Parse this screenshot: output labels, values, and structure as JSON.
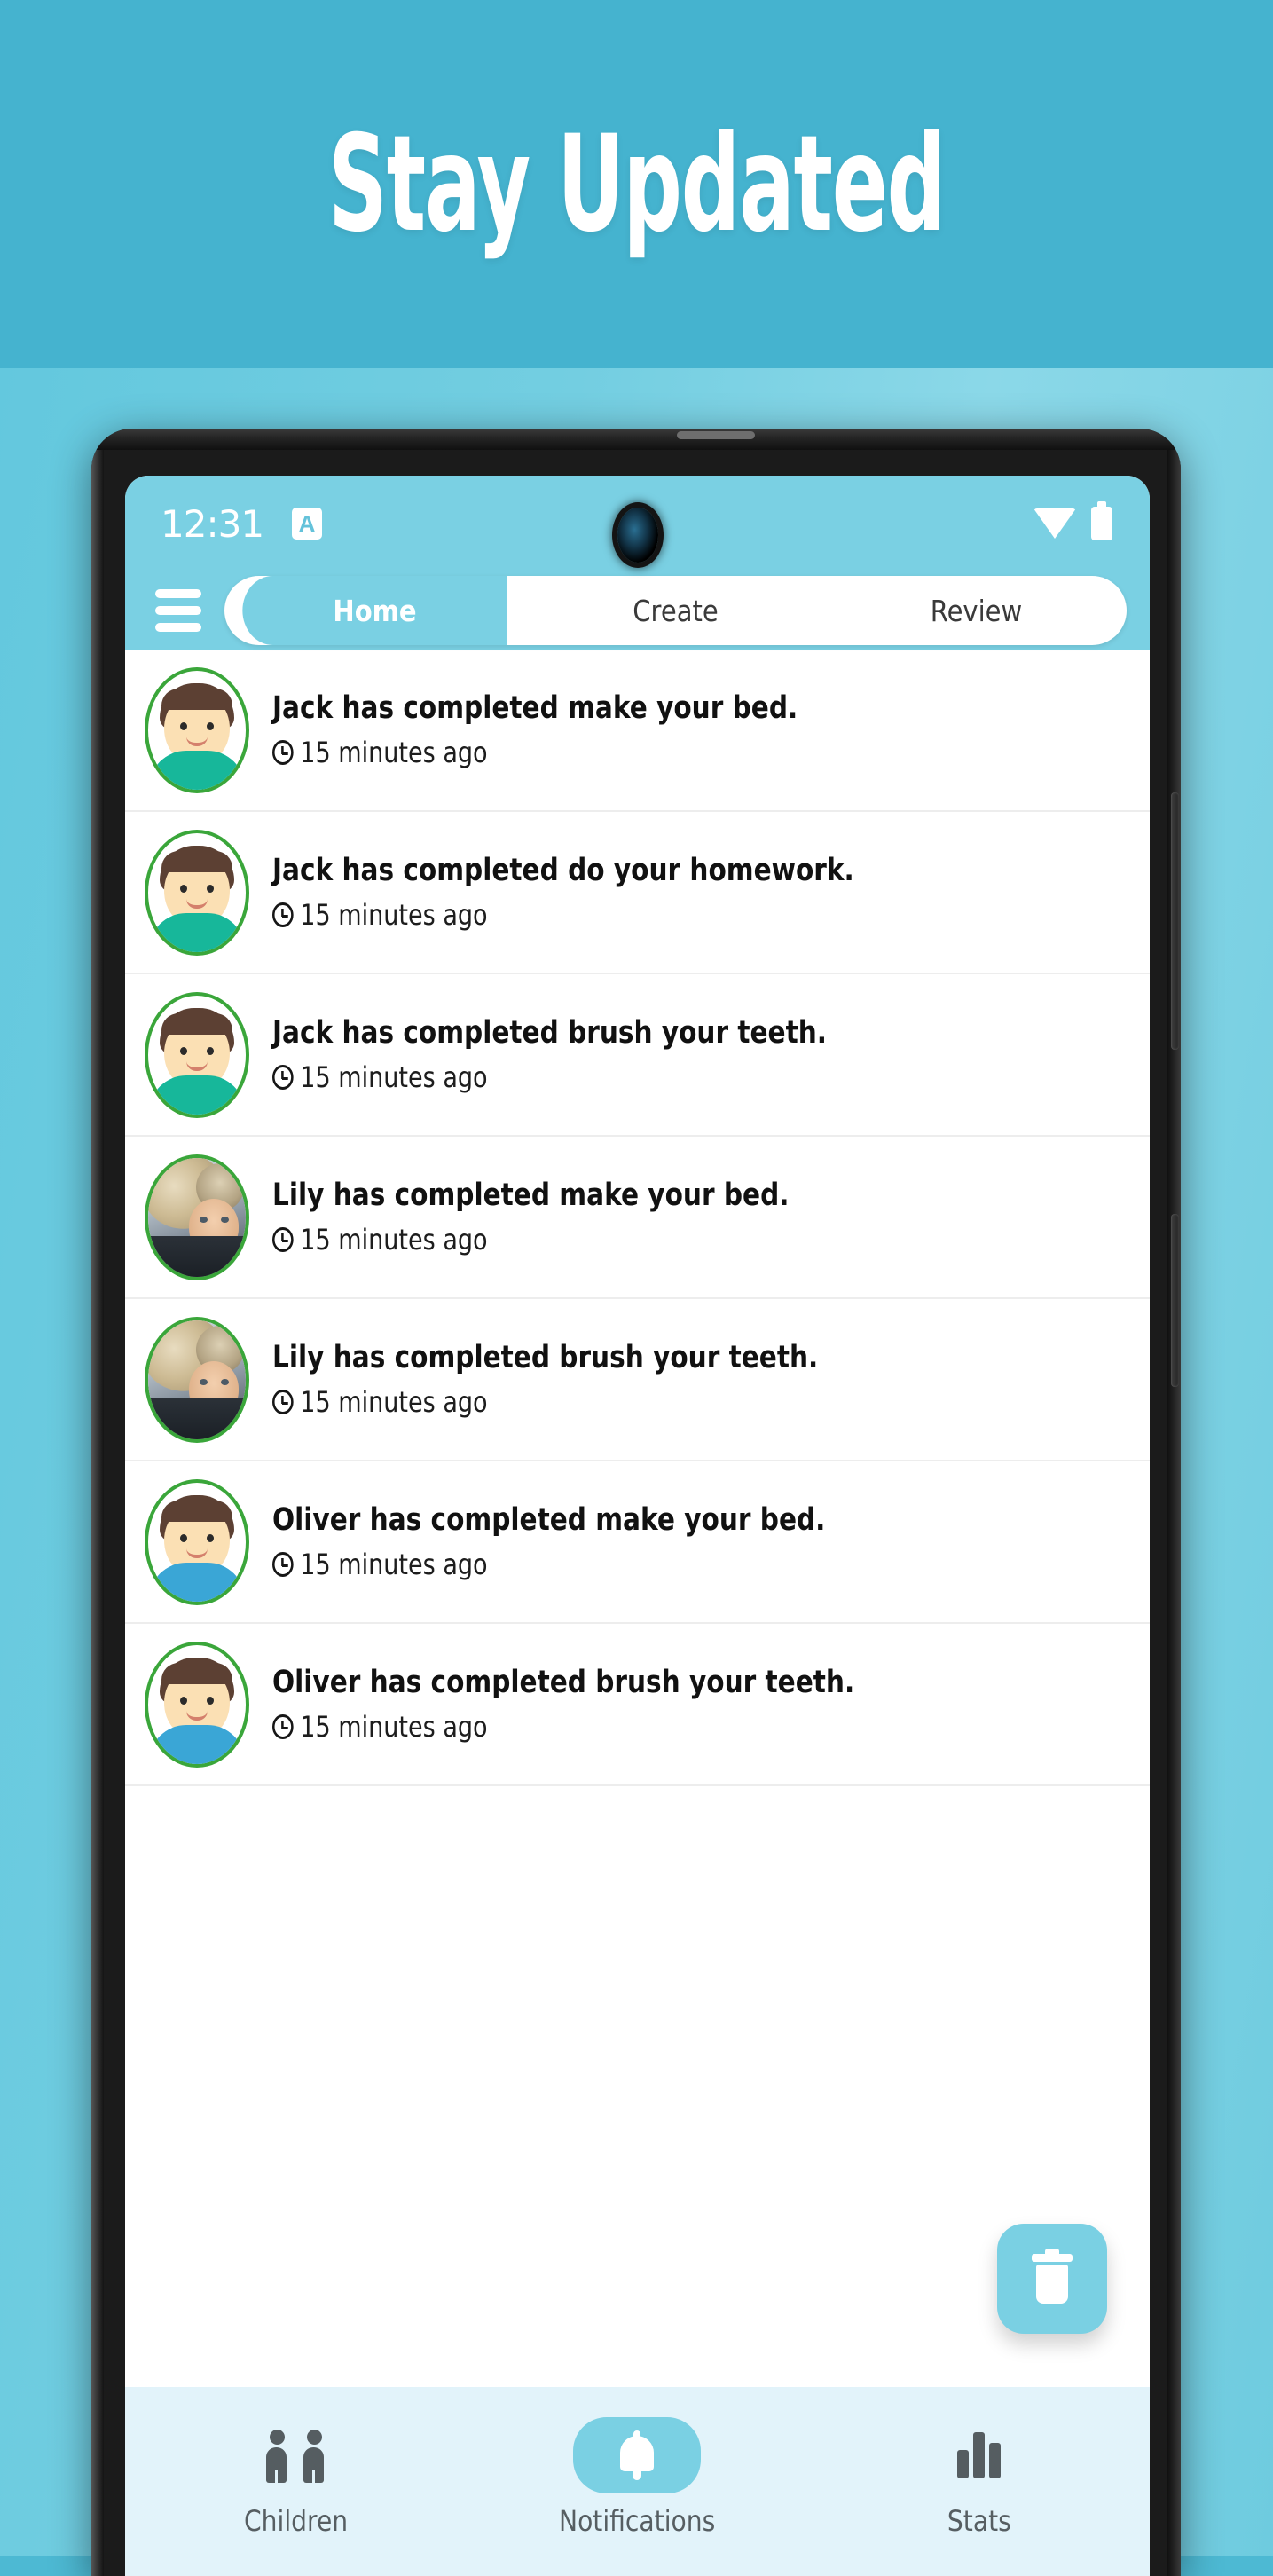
{
  "promo": {
    "title": "Stay Updated",
    "banner_color": "#45b3cf",
    "background_gradient_from": "#63c8de",
    "background_gradient_to": "#8bd8e8"
  },
  "phone": {
    "status_bar": {
      "time": "12:31",
      "badge_letter": "A",
      "badge_icon": "app-badge-icon",
      "wifi_icon": "wifi-icon",
      "battery_icon": "battery-full-icon",
      "camera_icon": "front-camera-punch-hole",
      "background_color": "#7ad0e3"
    },
    "side_buttons": [
      "volume-rocker",
      "power-button"
    ]
  },
  "app_bar": {
    "menu_icon": "hamburger-menu-icon",
    "accent_color": "#7ad0e3",
    "tabs": [
      {
        "label": "Home",
        "active": true
      },
      {
        "label": "Create",
        "active": false
      },
      {
        "label": "Review",
        "active": false
      }
    ]
  },
  "notifications": {
    "time_icon": "clock-icon",
    "avatar_ring_color": "#3aa63a",
    "items": [
      {
        "child": "Jack",
        "avatar": "cartoon-boy-teal-shirt",
        "title": "Jack has completed make your bed.",
        "time": "15 minutes ago"
      },
      {
        "child": "Jack",
        "avatar": "cartoon-boy-teal-shirt",
        "title": "Jack has completed do your homework.",
        "time": "15 minutes ago"
      },
      {
        "child": "Jack",
        "avatar": "cartoon-boy-teal-shirt",
        "title": "Jack has completed brush your teeth.",
        "time": "15 minutes ago"
      },
      {
        "child": "Lily",
        "avatar": "photo-girl-fur-hood",
        "title": "Lily has completed make your bed.",
        "time": "15 minutes ago"
      },
      {
        "child": "Lily",
        "avatar": "photo-girl-fur-hood",
        "title": "Lily has completed brush your teeth.",
        "time": "15 minutes ago"
      },
      {
        "child": "Oliver",
        "avatar": "cartoon-boy-blue-shirt",
        "title": "Oliver has completed make your bed.",
        "time": "15 minutes ago"
      },
      {
        "child": "Oliver",
        "avatar": "cartoon-boy-blue-shirt",
        "title": "Oliver has completed brush your teeth.",
        "time": "15 minutes ago"
      }
    ]
  },
  "fab": {
    "icon": "trash-icon",
    "color": "#7ad0e3"
  },
  "bottom_nav": {
    "background_color": "#e2f3fa",
    "active_color": "#7ad0e3",
    "items": [
      {
        "label": "Children",
        "icon": "children-icon",
        "active": false
      },
      {
        "label": "Notifications",
        "icon": "bell-icon",
        "active": true
      },
      {
        "label": "Stats",
        "icon": "bar-chart-icon",
        "active": false
      }
    ]
  }
}
